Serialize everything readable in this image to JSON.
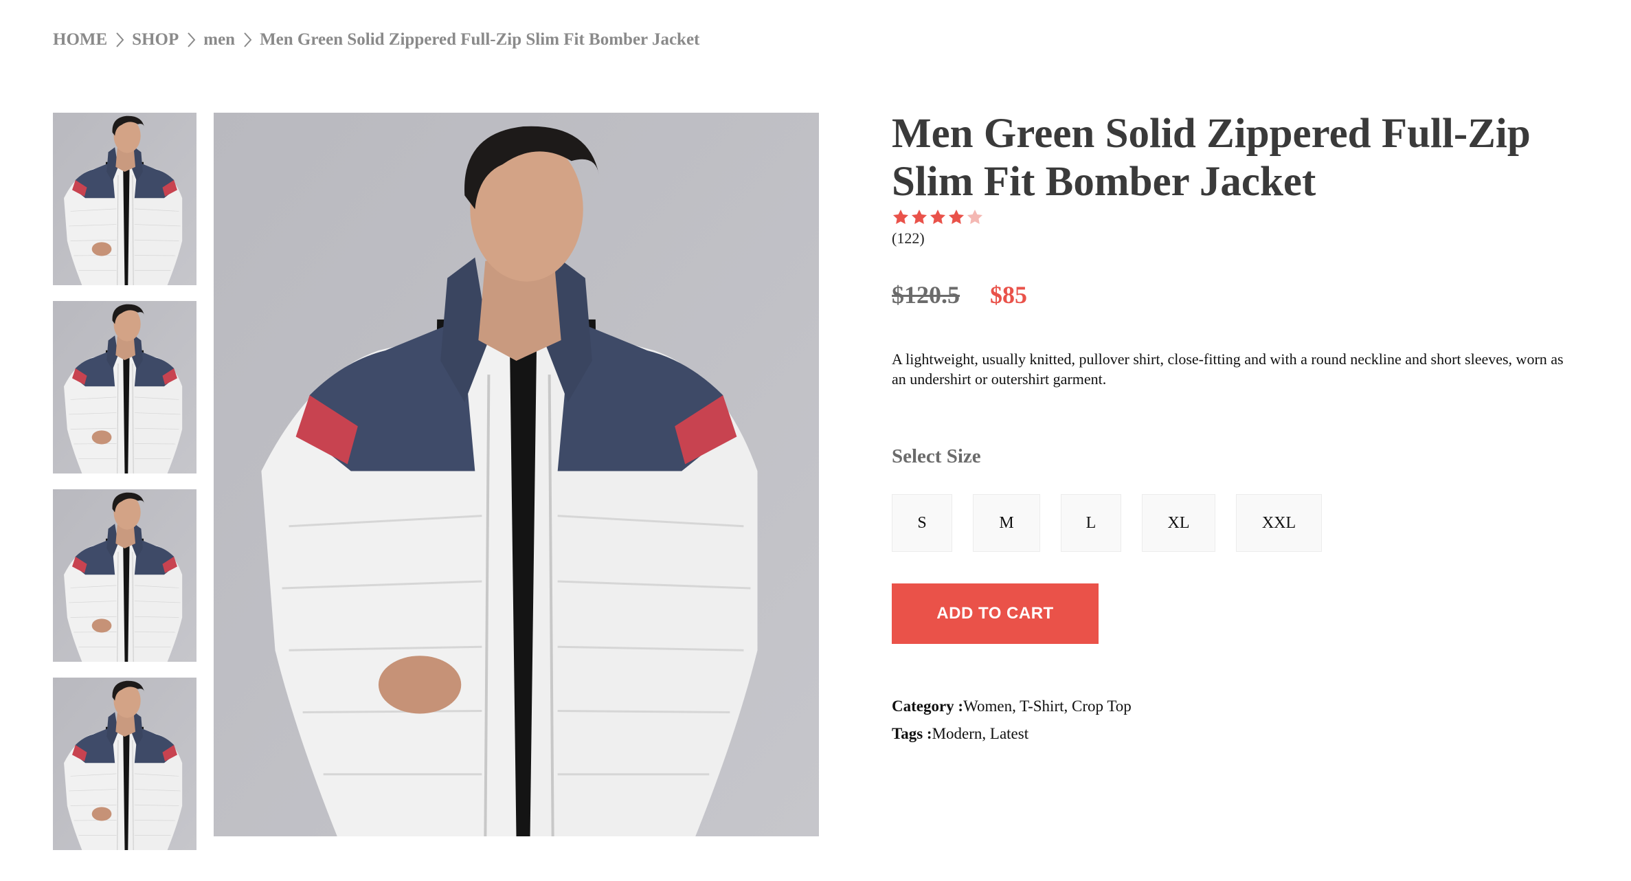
{
  "breadcrumb": {
    "items": [
      "HOME",
      "SHOP",
      "men",
      "Men Green Solid Zippered Full-Zip Slim Fit Bomber Jacket"
    ]
  },
  "product": {
    "title": "Men Green Solid Zippered Full-Zip Slim Fit Bomber Jacket",
    "rating": 4.5,
    "rating_max": 5,
    "reviews_count": "(122)",
    "old_price": "$120.5",
    "price": "$85",
    "description": "A lightweight, usually knitted, pullover shirt, close-fitting and with a round neckline and short sleeves, worn as an undershirt or outershirt garment.",
    "select_size_label": "Select Size",
    "sizes": [
      "S",
      "M",
      "L",
      "XL",
      "XXL"
    ],
    "add_to_cart_label": "ADD TO CART",
    "category_label": "Category :",
    "category_value": "Women, T-Shirt, Crop Top",
    "tags_label": "Tags :",
    "tags_value": "Modern, Latest"
  },
  "colors": {
    "accent": "#ea5249",
    "price_red": "#e9524a",
    "star_filled": "#e9524a",
    "star_empty": "#f4b8b3",
    "muted_text": "#8a8a8a",
    "title_text": "#3a3a3a"
  },
  "icons": {
    "breadcrumb_separator": "chevron-right-icon",
    "rating": "star-icon"
  }
}
